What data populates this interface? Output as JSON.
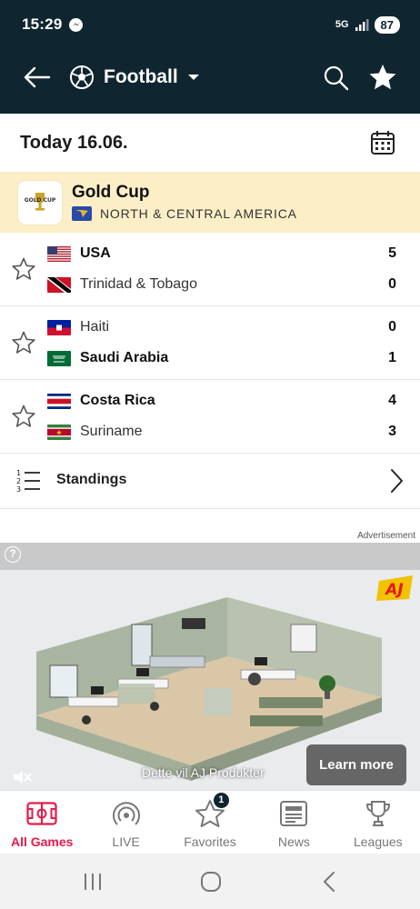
{
  "status_bar": {
    "time": "15:29",
    "network": "5G",
    "battery": "87"
  },
  "app_bar": {
    "sport": "Football"
  },
  "date_header": {
    "label": "Today 16.06."
  },
  "competition": {
    "name": "Gold Cup",
    "region": "NORTH & CENTRAL AMERICA"
  },
  "matches": [
    {
      "home": {
        "name": "USA",
        "score": "5",
        "winner": true,
        "flag": "usa"
      },
      "away": {
        "name": "Trinidad & Tobago",
        "score": "0",
        "winner": false,
        "flag": "tto"
      }
    },
    {
      "home": {
        "name": "Haiti",
        "score": "0",
        "winner": false,
        "flag": "hai"
      },
      "away": {
        "name": "Saudi Arabia",
        "score": "1",
        "winner": true,
        "flag": "ksa"
      }
    },
    {
      "home": {
        "name": "Costa Rica",
        "score": "4",
        "winner": true,
        "flag": "crc"
      },
      "away": {
        "name": "Suriname",
        "score": "3",
        "winner": false,
        "flag": "sur"
      }
    }
  ],
  "standings": {
    "label": "Standings"
  },
  "ad": {
    "label": "Advertisement",
    "caption": "Dette vil AJ Produkter",
    "cta": "Learn more",
    "info_icon": "?"
  },
  "bottom_nav": {
    "items": [
      {
        "label": "All Games",
        "icon": "scoreboard-icon",
        "active": true
      },
      {
        "label": "LIVE",
        "icon": "live-icon",
        "active": false
      },
      {
        "label": "Favorites",
        "icon": "star-icon",
        "active": false,
        "badge": "1"
      },
      {
        "label": "News",
        "icon": "news-icon",
        "active": false
      },
      {
        "label": "Leagues",
        "icon": "trophy-icon",
        "active": false
      }
    ]
  },
  "colors": {
    "header_bg": "#0f2630",
    "competition_bg": "#fcefc7",
    "active_accent": "#e8194b"
  }
}
